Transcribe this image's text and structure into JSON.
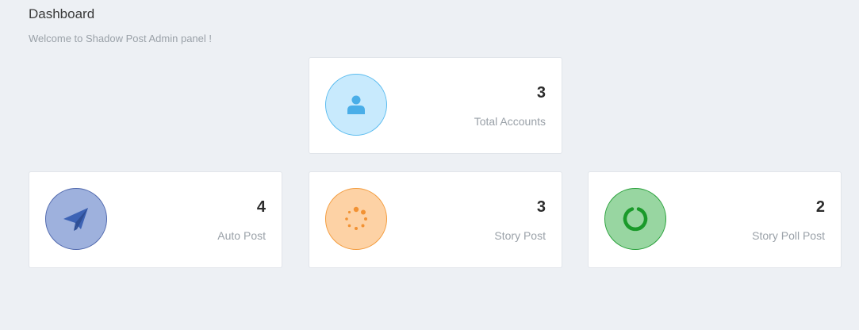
{
  "header": {
    "title": "Dashboard",
    "subtitle": "Welcome to Shadow Post Admin panel !"
  },
  "cards": [
    {
      "key": "total",
      "count": "3",
      "label": "Total Accounts",
      "icon": "user-icon",
      "bg": "#c8eafd",
      "border": "#5bbcef",
      "fg": "#4aaee8"
    },
    {
      "key": "auto",
      "count": "4",
      "label": "Auto Post",
      "icon": "paper-plane-icon",
      "bg": "#9eb1dd",
      "border": "#4f67ac",
      "fg": "#3d63b5"
    },
    {
      "key": "story",
      "count": "3",
      "label": "Story Post",
      "icon": "spinner-icon",
      "bg": "#fdd2a5",
      "border": "#f39b3c",
      "fg": "#f29233"
    },
    {
      "key": "poll",
      "count": "2",
      "label": "Story Poll Post",
      "icon": "circle-notch-icon",
      "bg": "#98d6a1",
      "border": "#28a03a",
      "fg": "#1a9a2a"
    }
  ]
}
